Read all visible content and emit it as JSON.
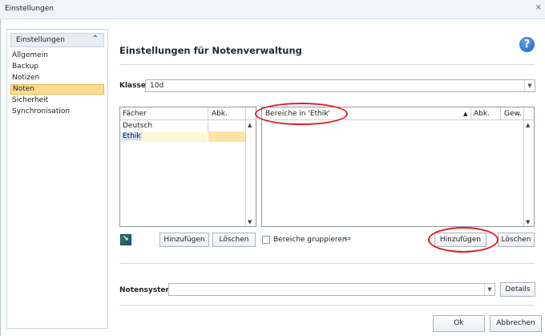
{
  "window": {
    "title": "Einstellungen",
    "close_glyph": "⨯"
  },
  "sidebar": {
    "header": "Einstellungen",
    "items": [
      {
        "label": "Allgemein"
      },
      {
        "label": "Backup"
      },
      {
        "label": "Notizen"
      },
      {
        "label": "Noten",
        "selected": true
      },
      {
        "label": "Sicherheit"
      },
      {
        "label": "Synchronisation"
      }
    ]
  },
  "main": {
    "title": "Einstellungen für Notenverwaltung",
    "help_icon": "help-icon",
    "klasse": {
      "label": "Klasse",
      "value": "10d"
    },
    "faecher_table": {
      "columns": [
        "Fächer",
        "Abk."
      ],
      "rows": [
        [
          "Deutsch",
          ""
        ],
        [
          "Ethik",
          ""
        ]
      ],
      "selected_row": 1
    },
    "bereiche_table": {
      "columns": [
        "Bereiche in 'Ethik'",
        "Abk.",
        "Gew."
      ],
      "rows": []
    },
    "faecher_buttons": {
      "add": "Hinzufügen",
      "delete": "Löschen"
    },
    "bereiche_group_label": "Bereiche gruppieren",
    "bereiche_buttons": {
      "add": "Hinzufügen",
      "delete": "Löschen"
    },
    "notensystem": {
      "label": "Notensystem",
      "value": "",
      "details": "Details"
    },
    "footer": {
      "ok": "Ok",
      "cancel": "Abbrechen"
    }
  },
  "colors": {
    "selection": "#fcdd8f",
    "highlight_text": "#cce0f8",
    "annotation": "#e01e22",
    "help": "#1a5fb8"
  }
}
